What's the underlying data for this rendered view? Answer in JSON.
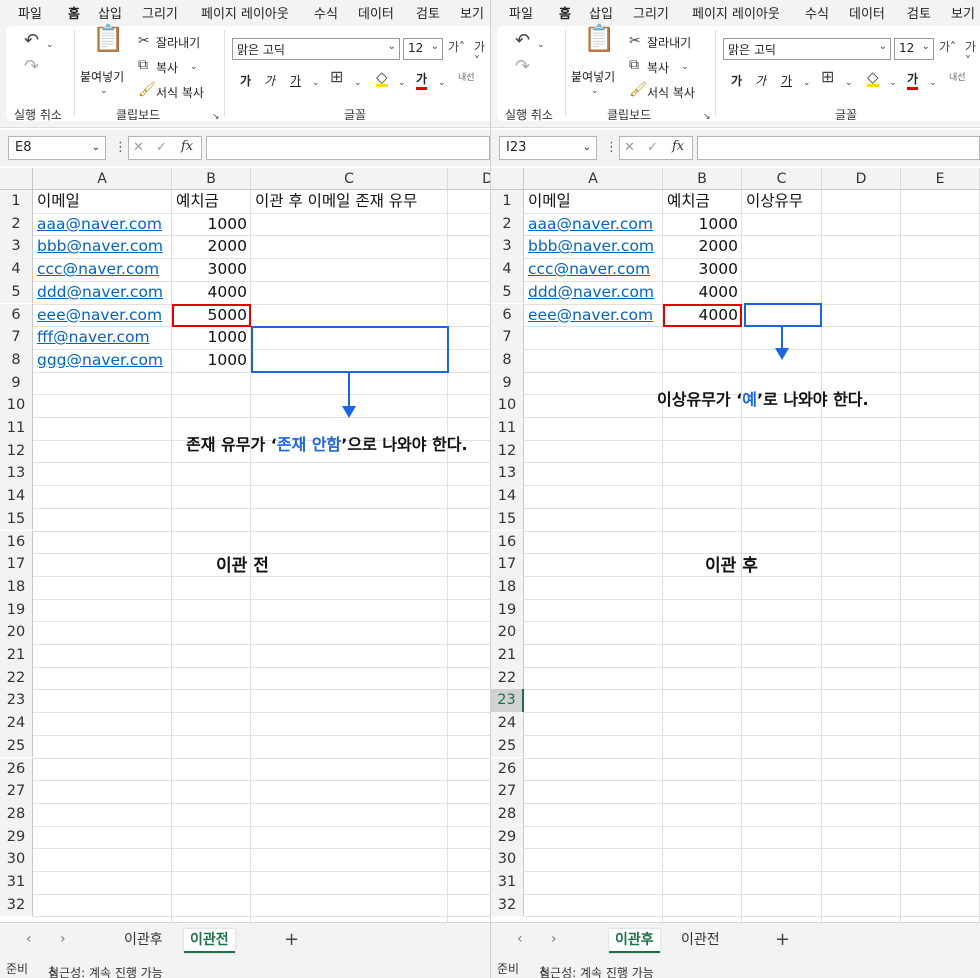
{
  "ribbon": {
    "tabs": [
      "파일",
      "홈",
      "삽입",
      "그리기",
      "페이지 레이아웃",
      "수식",
      "데이터",
      "검토",
      "보기"
    ],
    "active_tab": "홈",
    "undo_group_label": "실행 취소",
    "clipboard": {
      "paste": "붙여넣기",
      "cut": "잘라내기",
      "copy": "복사",
      "format_painter": "서식 복사",
      "group_label": "클립보드"
    },
    "font": {
      "name": "맑은 고딕",
      "size": "12",
      "group_label": "글꼴",
      "bold": "가",
      "italic": "가",
      "underline": "가",
      "font_color_glyph": "가",
      "phonetic": "내선"
    }
  },
  "status": {
    "ready": "준비",
    "accessibility": "접근성: 계속 진행 가능"
  },
  "left": {
    "namebox": "E8",
    "columns": [
      "A",
      "B",
      "C",
      "D"
    ],
    "rows": [
      "1",
      "2",
      "3",
      "4",
      "5",
      "6",
      "7",
      "8",
      "9",
      "10",
      "11",
      "12",
      "13",
      "14",
      "15",
      "16",
      "17",
      "18",
      "19",
      "20",
      "21",
      "22",
      "23",
      "24",
      "25",
      "26",
      "27",
      "28",
      "29",
      "30",
      "31",
      "32"
    ],
    "header": {
      "a": "이메일",
      "b": "예치금",
      "c": "이관 후 이메일 존재 유무"
    },
    "emails": [
      "aaa@naver.com",
      "bbb@naver.com",
      "ccc@naver.com",
      "ddd@naver.com",
      "eee@naver.com",
      "fff@naver.com",
      "ggg@naver.com"
    ],
    "deposits": [
      "1000",
      "2000",
      "3000",
      "4000",
      "5000",
      "1000",
      "1000"
    ],
    "note_before": "존재 유무가 ‘",
    "note_highlight": "존재 안함",
    "note_after": "’으로 나와야 한다.",
    "caption": "이관 전",
    "sheets": [
      "이관후",
      "이관전"
    ],
    "active_sheet": "이관전"
  },
  "right": {
    "namebox": "I23",
    "columns": [
      "A",
      "B",
      "C",
      "D",
      "E"
    ],
    "rows": [
      "1",
      "2",
      "3",
      "4",
      "5",
      "6",
      "7",
      "8",
      "9",
      "10",
      "11",
      "12",
      "13",
      "14",
      "15",
      "16",
      "17",
      "18",
      "19",
      "20",
      "21",
      "22",
      "23",
      "24",
      "25",
      "26",
      "27",
      "28",
      "29",
      "30",
      "31",
      "32"
    ],
    "selected_row": "23",
    "header": {
      "a": "이메일",
      "b": "예치금",
      "c": "이상유무"
    },
    "emails": [
      "aaa@naver.com",
      "bbb@naver.com",
      "ccc@naver.com",
      "ddd@naver.com",
      "eee@naver.com"
    ],
    "deposits": [
      "1000",
      "2000",
      "3000",
      "4000",
      "4000"
    ],
    "note_before": "이상유무가 ‘",
    "note_highlight": "예",
    "note_after": "’로 나와야 한다.",
    "caption": "이관 후",
    "sheets": [
      "이관후",
      "이관전"
    ],
    "active_sheet": "이관후"
  }
}
